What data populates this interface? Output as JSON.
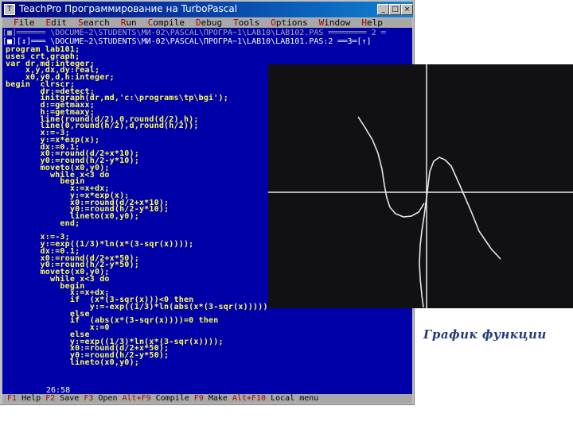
{
  "window": {
    "title": "TeachPro Программирование на TurboPascal",
    "buttons": {
      "minimize": "_",
      "maximize": "□",
      "close": "×"
    }
  },
  "menu": [
    "File",
    "Edit",
    "Search",
    "Run",
    "Compile",
    "Debug",
    "Tools",
    "Options",
    "Window",
    "Help"
  ],
  "frames": {
    "back": "[■]══════ \\DOCUME~2\\STUDENTS\\МИ-02\\PASCAL\\ПРОГРА~1\\LAB10\\LAB102.PAS ════════ 2 ═",
    "front": "[■][↕]═══ \\DOCUME~2\\STUDENTS\\МИ-02\\PASCAL\\ПРОГРА~1\\LAB10\\LAB101.PAS:2 ══3═[↑]"
  },
  "code": [
    "program lab101;",
    "uses crt,graph;",
    "var dr,md:integer;",
    "    x,y,dx,dy:real;",
    "    x0,y0,d,h:integer;",
    "begin  clrscr;",
    "       dr:=detect;",
    "       initgraph(dr,md,'c:\\programs\\tp\\bgi');",
    "       d:=getmaxx;",
    "       h:=getmaxy;",
    "       line(round(d/2),0,round(d/2),h);",
    "       line(0,round(h/2),d,round(h/2));",
    "       x:=-3;",
    "       y:=x*exp(x);",
    "       dx:=0.1;",
    "       x0:=round(d/2+x*10);",
    "       y0:=round(h/2-y*10);",
    "       moveto(x0,y0);",
    "         while x<3 do",
    "           begin",
    "             x:=x+dx;",
    "             y:=x*exp(x);",
    "             x0:=round(d/2+x*10);",
    "             y0:=round(h/2-y*10);",
    "             lineto(x0,y0);",
    "           end;",
    "",
    "       x:=-3;",
    "       y:=exp((1/3)*ln(x*(3-sqr(x))));",
    "       dx:=0.1;",
    "       x0:=round(d/2+x*50);",
    "       y0:=round(h/2-y*50);",
    "       moveto(x0,y0);",
    "         while x<3 do",
    "           begin",
    "             x:=x+dx;",
    "             if  (x*(3-sqr(x)))<0 then",
    "                 y:=-exp((1/3)*ln(abs(x*(3-sqr(x)))))",
    "             else",
    "             if  (abs(x*(3-sqr(x))))=0 then",
    "                 x:=0",
    "             else",
    "             y:=exp((1/3)*ln(x*(3-sqr(x))));",
    "             x0:=round(d/2+x*50);",
    "             y0:=round(h/2-y*50);",
    "             lineto(x0,y0);"
  ],
  "cursor_position": "26:58",
  "status_bar": [
    {
      "key": "F1",
      "label": "Help"
    },
    {
      "key": "F2",
      "label": "Save"
    },
    {
      "key": "F3",
      "label": "Open"
    },
    {
      "key": "Alt+F9",
      "label": "Compile"
    },
    {
      "key": "F9",
      "label": "Make"
    },
    {
      "key": "Alt+F10",
      "label": "Local menu"
    }
  ],
  "caption": "График функции",
  "colors": {
    "editor_bg": "#0000a8",
    "code_text": "#ffff55",
    "menu_bg": "#a8a8a8",
    "hotkey": "#a80000",
    "caption": "#1f3d7a"
  }
}
